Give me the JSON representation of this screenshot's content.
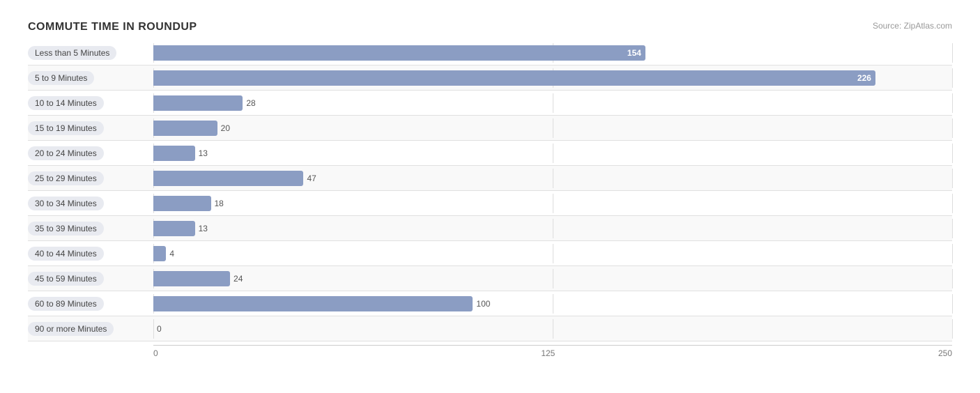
{
  "chart": {
    "title": "COMMUTE TIME IN ROUNDUP",
    "source": "Source: ZipAtlas.com",
    "max_value": 250,
    "axis_labels": [
      "0",
      "125",
      "250"
    ],
    "bars": [
      {
        "label": "Less than 5 Minutes",
        "value": 154,
        "value_inside": true
      },
      {
        "label": "5 to 9 Minutes",
        "value": 226,
        "value_inside": true
      },
      {
        "label": "10 to 14 Minutes",
        "value": 28,
        "value_inside": false
      },
      {
        "label": "15 to 19 Minutes",
        "value": 20,
        "value_inside": false
      },
      {
        "label": "20 to 24 Minutes",
        "value": 13,
        "value_inside": false
      },
      {
        "label": "25 to 29 Minutes",
        "value": 47,
        "value_inside": false
      },
      {
        "label": "30 to 34 Minutes",
        "value": 18,
        "value_inside": false
      },
      {
        "label": "35 to 39 Minutes",
        "value": 13,
        "value_inside": false
      },
      {
        "label": "40 to 44 Minutes",
        "value": 4,
        "value_inside": false
      },
      {
        "label": "45 to 59 Minutes",
        "value": 24,
        "value_inside": false
      },
      {
        "label": "60 to 89 Minutes",
        "value": 100,
        "value_inside": false
      },
      {
        "label": "90 or more Minutes",
        "value": 0,
        "value_inside": false
      }
    ]
  }
}
